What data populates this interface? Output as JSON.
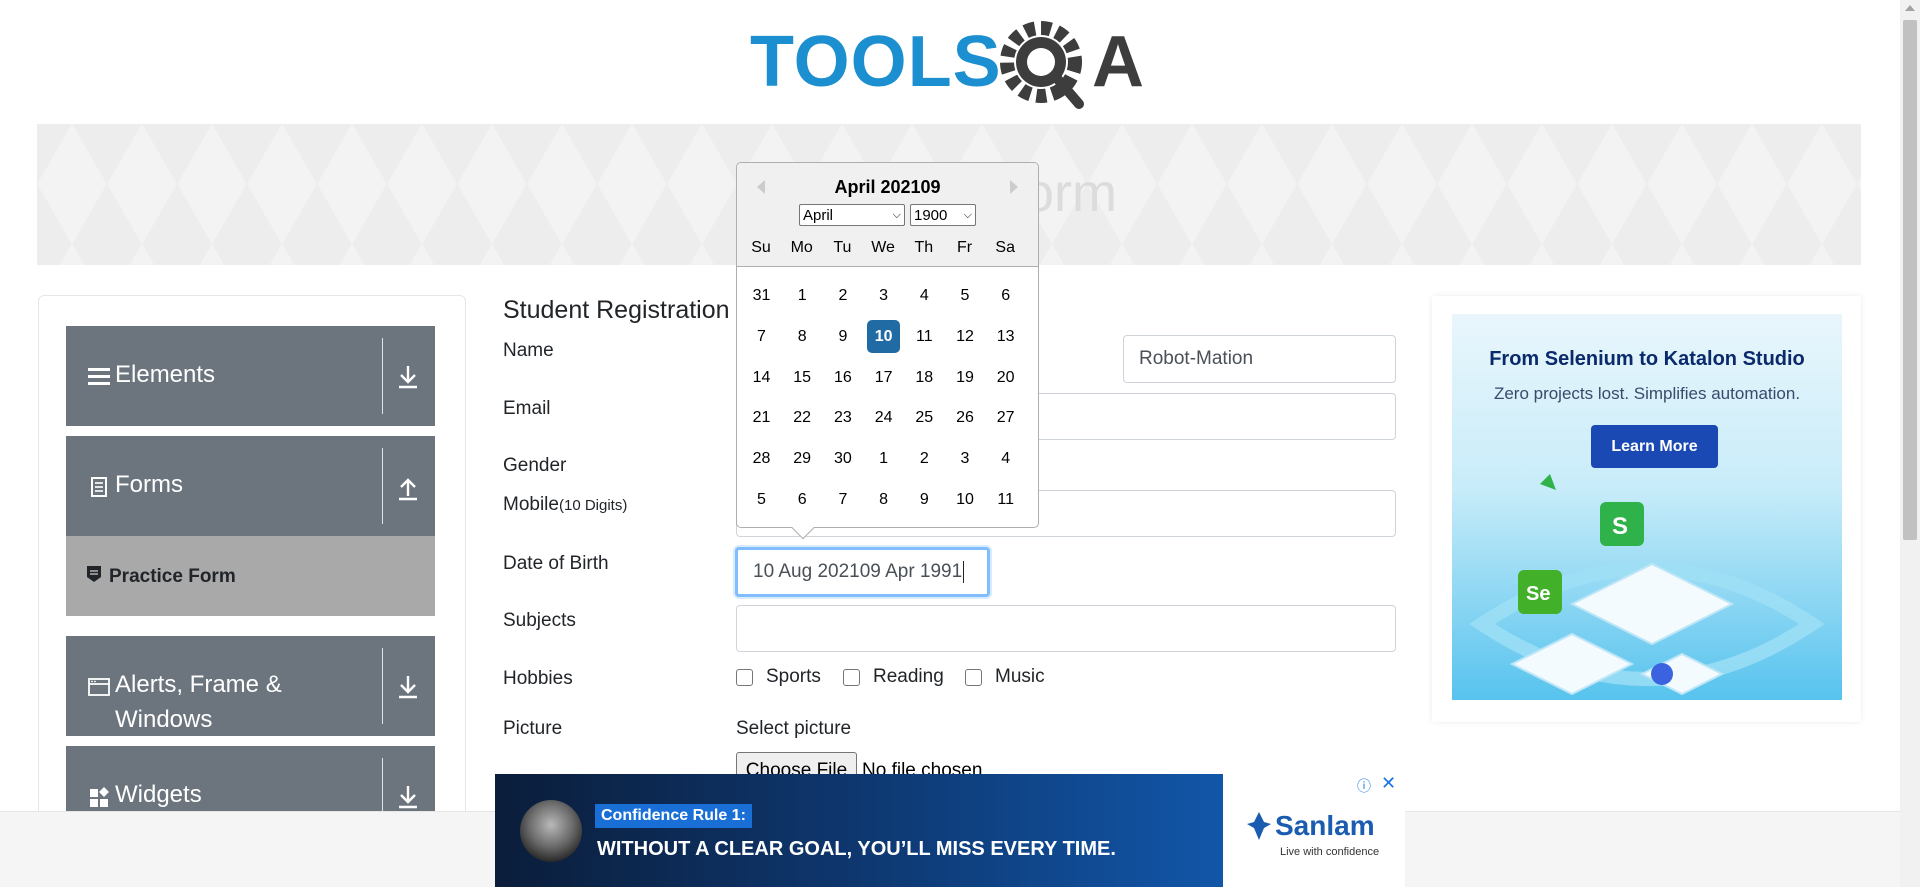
{
  "header": {
    "logo_text": "TOOLSQA"
  },
  "banner": {
    "title": "Practice Form"
  },
  "sidebar": {
    "groups": [
      {
        "label": "Elements",
        "icon": "hamburger-icon",
        "expanded": false
      },
      {
        "label": "Forms",
        "icon": "document-icon",
        "expanded": true
      },
      {
        "label": "Alerts, Frame &",
        "label2": "Windows",
        "icon": "window-icon",
        "expanded": false
      },
      {
        "label": "Widgets",
        "icon": "widgets-icon",
        "expanded": false
      }
    ],
    "sub_items": [
      {
        "label": "Practice Form",
        "icon": "form-icon"
      }
    ]
  },
  "form": {
    "title": "Student Registration",
    "labels": {
      "name": "Name",
      "email": "Email",
      "gender": "Gender",
      "mobile": "Mobile",
      "mobile_hint": "(10 Digits)",
      "dob": "Date of Birth",
      "subjects": "Subjects",
      "hobbies": "Hobbies",
      "picture": "Picture"
    },
    "last_name_value": "Robot-Mation",
    "dob_value": "10 Aug 202109 Apr 1991",
    "hobbies": [
      "Sports",
      "Reading",
      "Music"
    ],
    "picture_select_label": "Select picture",
    "file_button": "Choose File",
    "file_status": "No file chosen"
  },
  "datepicker": {
    "current_month": "April 202109",
    "month_select": "April",
    "year_select": "1900",
    "weekdays": [
      "Su",
      "Mo",
      "Tu",
      "We",
      "Th",
      "Fr",
      "Sa"
    ],
    "weeks": [
      [
        "31",
        "1",
        "2",
        "3",
        "4",
        "5",
        "6"
      ],
      [
        "7",
        "8",
        "9",
        "10",
        "11",
        "12",
        "13"
      ],
      [
        "14",
        "15",
        "16",
        "17",
        "18",
        "19",
        "20"
      ],
      [
        "21",
        "22",
        "23",
        "24",
        "25",
        "26",
        "27"
      ],
      [
        "28",
        "29",
        "30",
        "1",
        "2",
        "3",
        "4"
      ],
      [
        "5",
        "6",
        "7",
        "8",
        "9",
        "10",
        "11"
      ]
    ],
    "selected": "10"
  },
  "ad_right": {
    "headline": "From Selenium to Katalon Studio",
    "subline": "Zero projects lost. Simplifies automation.",
    "button": "Learn More"
  },
  "ad_bottom": {
    "tag": "Confidence Rule 1:",
    "main": "WITHOUT A CLEAR GOAL, YOU’LL MISS EVERY TIME.",
    "brand": "Sanlam",
    "slogan": "Live with confidence"
  },
  "colors": {
    "sidebar_group": "#6c757d",
    "sub_item": "#a9a9a9",
    "selected_day": "#216ba5",
    "logo_blue": "#1b8fcf",
    "logo_dark": "#3d3d3d"
  }
}
